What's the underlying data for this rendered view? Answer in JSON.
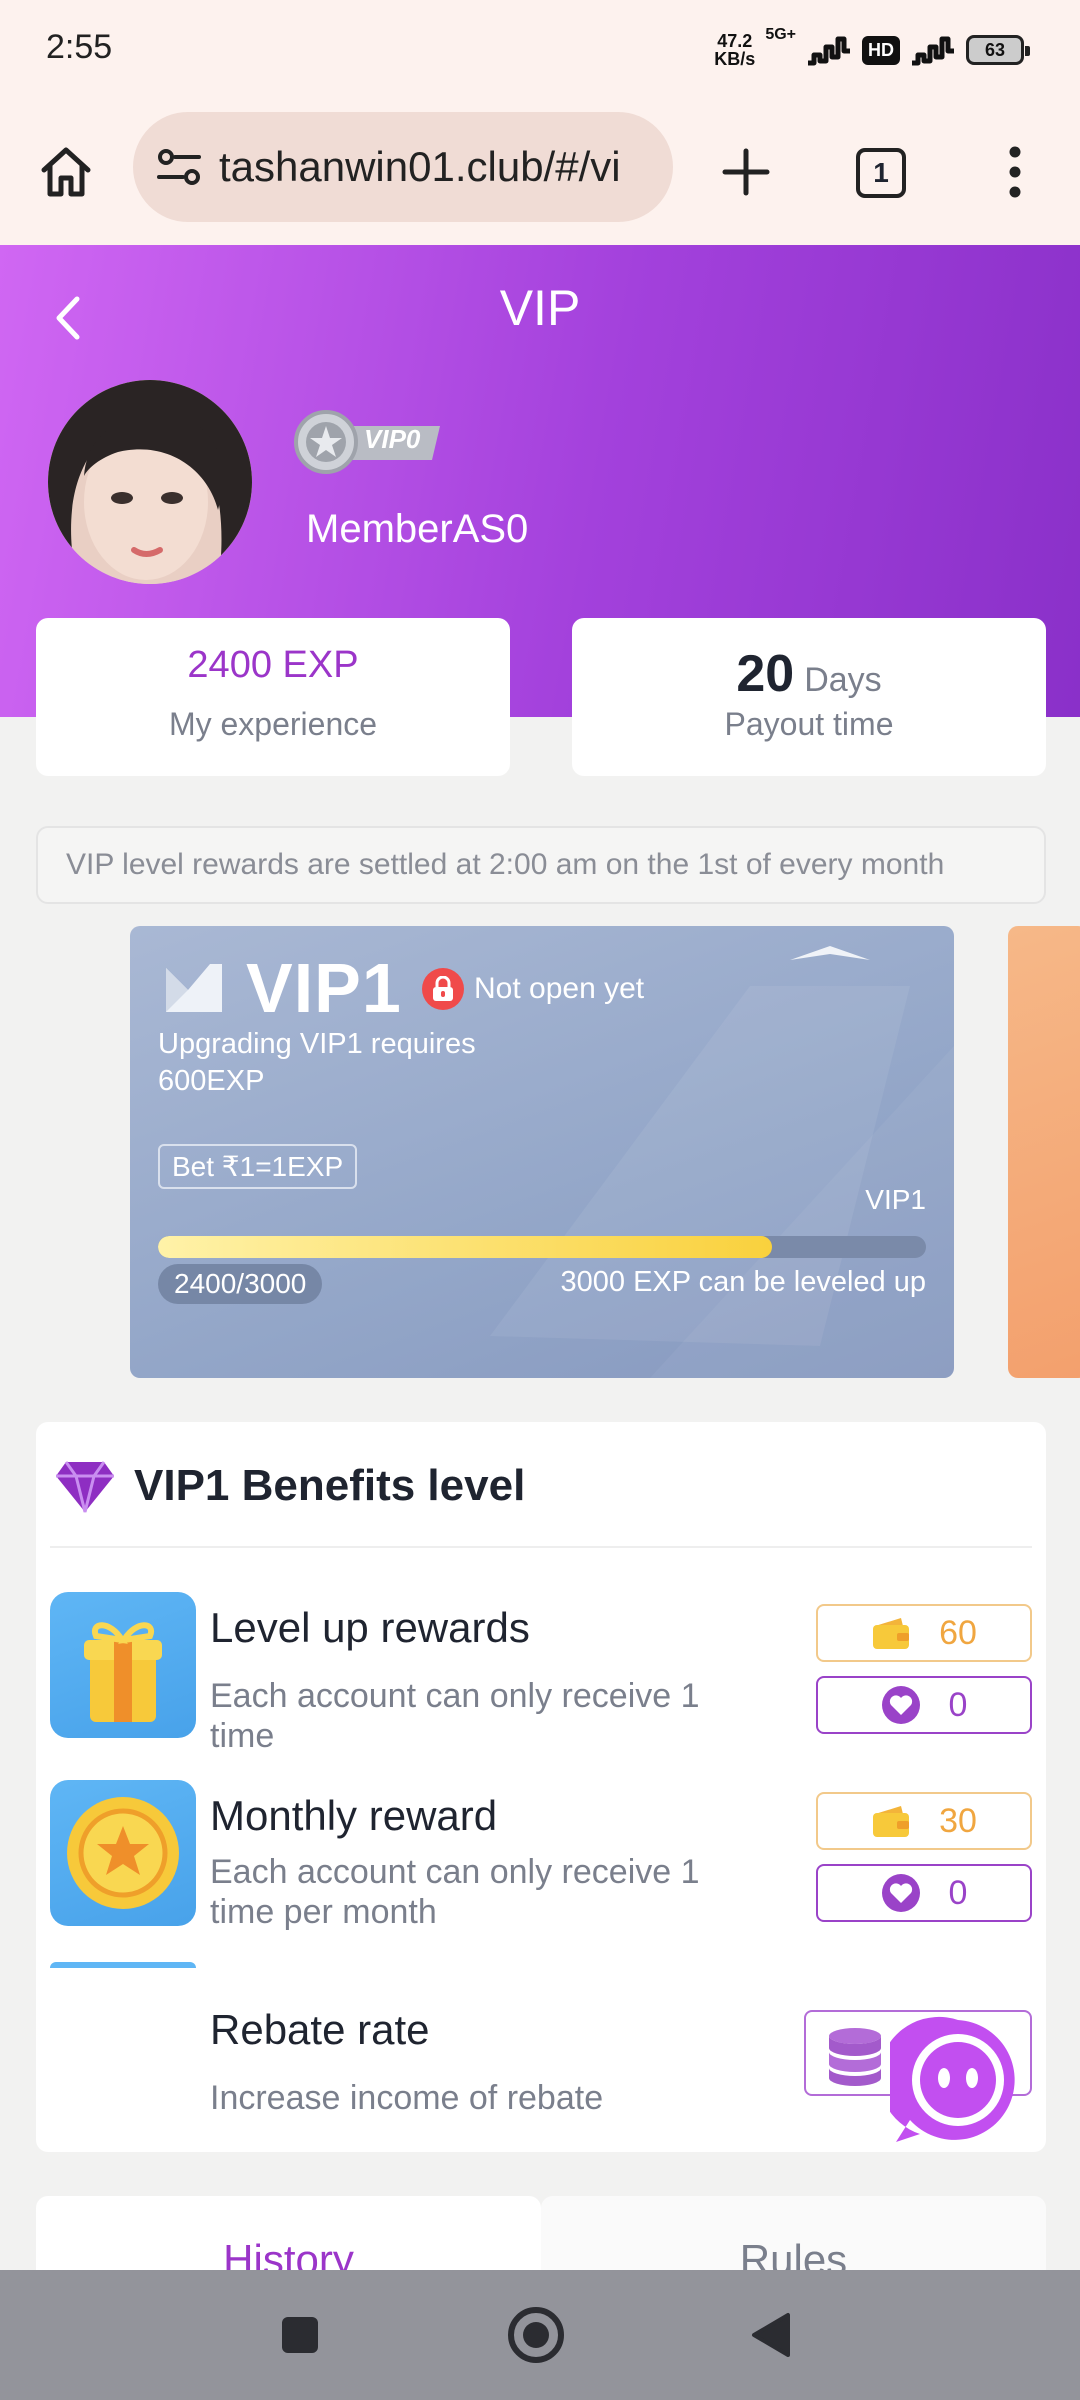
{
  "status_bar": {
    "time": "2:55",
    "speed_value": "47.2",
    "speed_unit": "KB/s",
    "network": "5G+",
    "hd": "HD",
    "battery": "63"
  },
  "browser": {
    "url": "tashanwin01.club/#/vi",
    "tab_count": "1"
  },
  "header": {
    "title": "VIP",
    "vip_badge": "VIP0",
    "username": "MemberAS0"
  },
  "stats": {
    "experience_value": "2400 EXP",
    "experience_label": "My experience",
    "days_value": "20",
    "days_unit": "Days",
    "days_label": "Payout time"
  },
  "notice": "VIP level rewards are settled at 2:00 am on the 1st of every month",
  "vip_card": {
    "level": "VIP1",
    "status": "Not open yet",
    "requirement": "Upgrading VIP1 requires 600EXP",
    "bet_rule": "Bet ₹1=1EXP",
    "target": "VIP1",
    "progress_text": "2400/3000",
    "progress_fraction": 0.8,
    "progress_note": "3000 EXP can be leveled up"
  },
  "benefits": {
    "title": "VIP1 Benefits level",
    "items": [
      {
        "title": "Level up rewards",
        "desc": "Each account can only receive 1 time",
        "coin": "60",
        "heart": "0",
        "icon": "gift-icon"
      },
      {
        "title": "Monthly reward",
        "desc": "Each account can only receive 1 time per month",
        "coin": "30",
        "heart": "0",
        "icon": "star-coin-icon"
      },
      {
        "title": "Rebate rate",
        "desc": "Increase income of rebate",
        "icon": "coin-stack-icon"
      }
    ]
  },
  "tabs": [
    {
      "label": "History",
      "active": true
    },
    {
      "label": "Rules",
      "active": false
    }
  ],
  "colors": {
    "accent": "#9b35c9",
    "header_start": "#d067f3",
    "header_end": "#8a30c9",
    "coin": "#f0a640",
    "progress": "#f9d13d"
  }
}
